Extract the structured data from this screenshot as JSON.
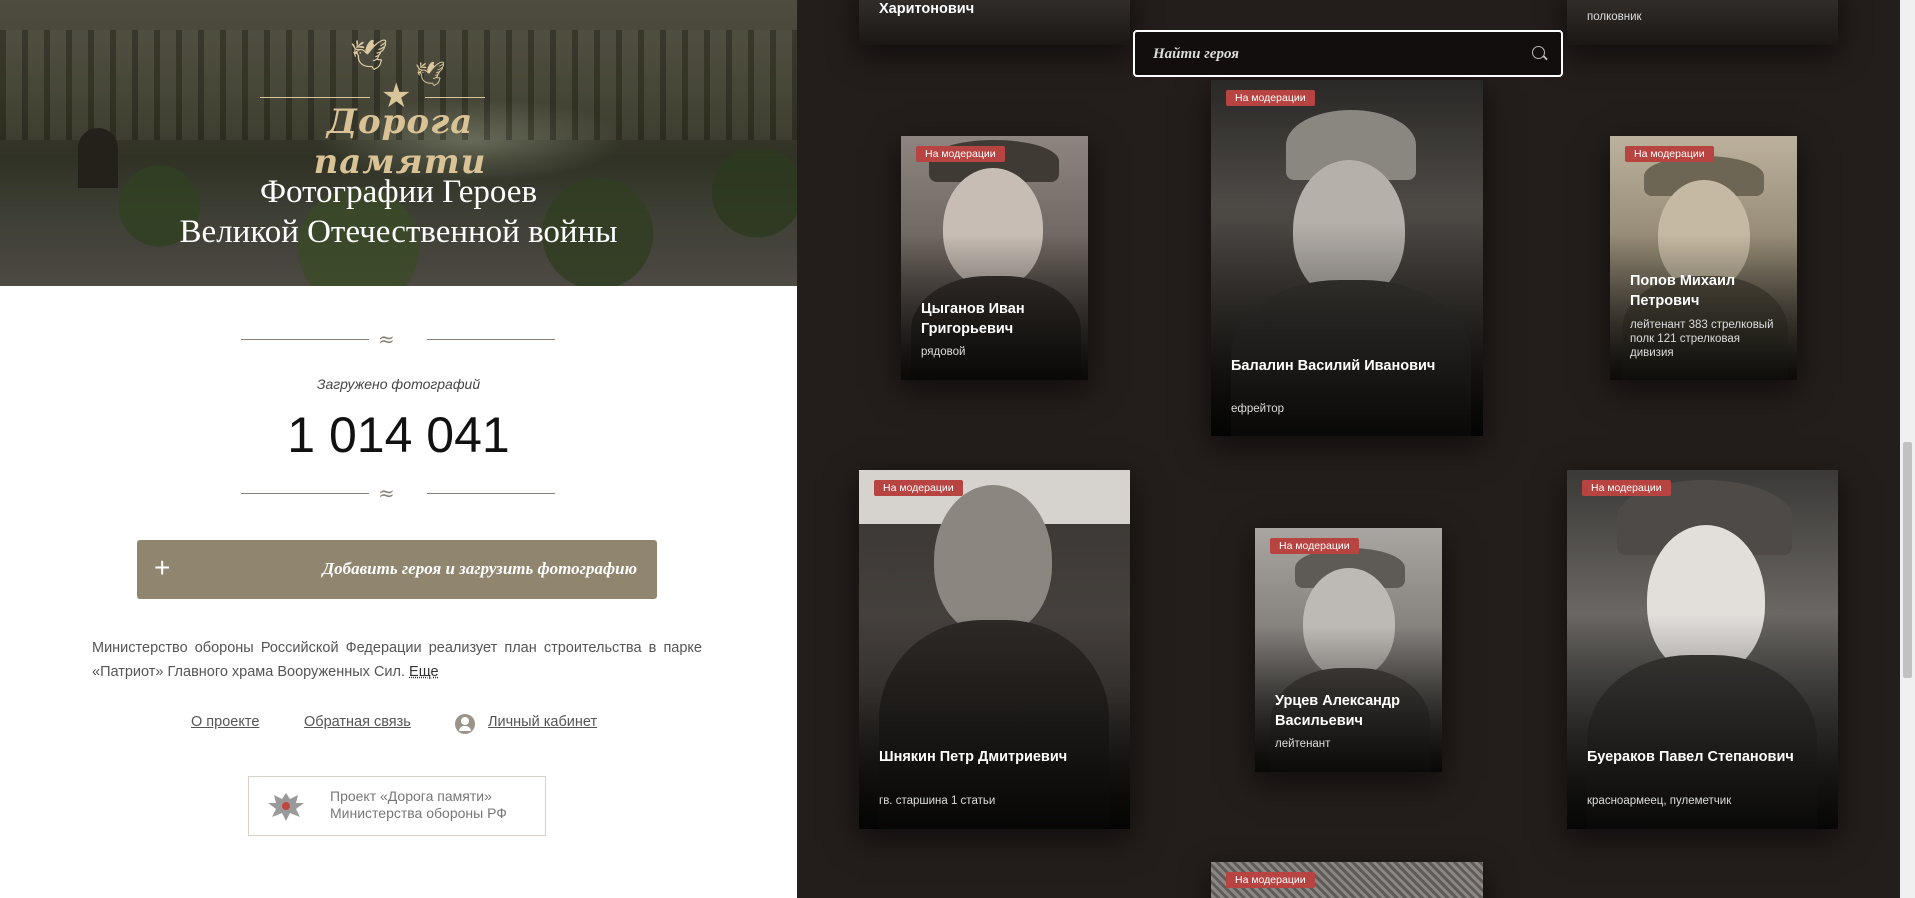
{
  "header": {
    "logo_text": "Дорога памяти",
    "title_line1": "Фотографии Героев",
    "title_line2": "Великой Отечественной войны"
  },
  "stats": {
    "label": "Загружено фотографий",
    "count": "1 014 041"
  },
  "add_button": {
    "icon": "+",
    "label": "Добавить героя и загрузить фотографию"
  },
  "about": {
    "text": "Министерство обороны Российской Федерации реализует план строительства в парке «Патриот» Главного храма Вооруженных Сил.",
    "more": "Еще"
  },
  "links": {
    "about": "О проекте",
    "feedback": "Обратная связь",
    "cabinet": "Личный кабинет"
  },
  "ministry": {
    "line1": "Проект «Дорога памяти»",
    "line2": "Министерства обороны РФ"
  },
  "search": {
    "placeholder": "Найти героя",
    "value": ""
  },
  "cards": {
    "top_left": {
      "name": "Харитонович",
      "rank": ""
    },
    "top_right": {
      "name": "",
      "rank": "полковник"
    },
    "c1": {
      "badge": "На модерации",
      "name": "Цыганов Иван Григорьевич",
      "rank": "рядовой"
    },
    "c2": {
      "badge": "На модерации",
      "name": "Балалин Василий Иванович",
      "rank": "ефрейтор"
    },
    "c3": {
      "badge": "На модерации",
      "name": "Попов Михаил Петрович",
      "rank": "лейтенант 383 стрелковый полк 121 стрелковая дивизия"
    },
    "c4": {
      "badge": "На модерации",
      "name": "Шнякин Петр Дмитриевич",
      "rank": "гв. старшина 1 статьи"
    },
    "c5": {
      "badge": "На модерации",
      "name": "Урцев Александр Васильевич",
      "rank": "лейтенант"
    },
    "c6": {
      "badge": "На модерации",
      "name": "Буераков Павел Степанович",
      "rank": "красноармеец, пулеметчик"
    },
    "c7": {
      "badge": "На модерации"
    }
  }
}
